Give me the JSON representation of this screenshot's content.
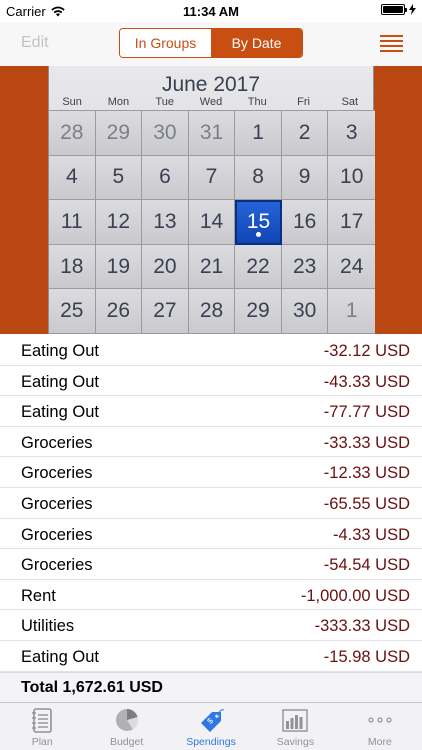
{
  "status": {
    "carrier": "Carrier",
    "time": "11:34 AM"
  },
  "nav": {
    "edit_label": "Edit",
    "segments": [
      {
        "label": "In Groups",
        "selected": false
      },
      {
        "label": "By Date",
        "selected": true
      }
    ],
    "menu_icon": "list-icon"
  },
  "calendar": {
    "title": "June 2017",
    "weekdays": [
      "Sun",
      "Mon",
      "Tue",
      "Wed",
      "Thu",
      "Fri",
      "Sat"
    ],
    "days": [
      {
        "d": "28",
        "cur": false
      },
      {
        "d": "29",
        "cur": false
      },
      {
        "d": "30",
        "cur": false
      },
      {
        "d": "31",
        "cur": false
      },
      {
        "d": "1",
        "cur": true
      },
      {
        "d": "2",
        "cur": true
      },
      {
        "d": "3",
        "cur": true
      },
      {
        "d": "4",
        "cur": true
      },
      {
        "d": "5",
        "cur": true
      },
      {
        "d": "6",
        "cur": true
      },
      {
        "d": "7",
        "cur": true
      },
      {
        "d": "8",
        "cur": true
      },
      {
        "d": "9",
        "cur": true
      },
      {
        "d": "10",
        "cur": true
      },
      {
        "d": "11",
        "cur": true
      },
      {
        "d": "12",
        "cur": true
      },
      {
        "d": "13",
        "cur": true
      },
      {
        "d": "14",
        "cur": true
      },
      {
        "d": "15",
        "cur": true,
        "selected": true,
        "event": true
      },
      {
        "d": "16",
        "cur": true
      },
      {
        "d": "17",
        "cur": true
      },
      {
        "d": "18",
        "cur": true
      },
      {
        "d": "19",
        "cur": true
      },
      {
        "d": "20",
        "cur": true
      },
      {
        "d": "21",
        "cur": true
      },
      {
        "d": "22",
        "cur": true
      },
      {
        "d": "23",
        "cur": true
      },
      {
        "d": "24",
        "cur": true
      },
      {
        "d": "25",
        "cur": true
      },
      {
        "d": "26",
        "cur": true
      },
      {
        "d": "27",
        "cur": true
      },
      {
        "d": "28",
        "cur": true
      },
      {
        "d": "29",
        "cur": true
      },
      {
        "d": "30",
        "cur": true
      },
      {
        "d": "1",
        "cur": false
      }
    ]
  },
  "transactions": [
    {
      "category": "Eating Out",
      "amount": "-32.12 USD"
    },
    {
      "category": "Eating Out",
      "amount": "-43.33 USD"
    },
    {
      "category": "Eating Out",
      "amount": "-77.77 USD"
    },
    {
      "category": "Groceries",
      "amount": "-33.33 USD"
    },
    {
      "category": "Groceries",
      "amount": "-12.33 USD"
    },
    {
      "category": "Groceries",
      "amount": "-65.55 USD"
    },
    {
      "category": "Groceries",
      "amount": "-4.33 USD"
    },
    {
      "category": "Groceries",
      "amount": "-54.54 USD"
    },
    {
      "category": "Rent",
      "amount": "-1,000.00 USD"
    },
    {
      "category": "Utilities",
      "amount": "-333.33 USD"
    },
    {
      "category": "Eating Out",
      "amount": "-15.98 USD"
    }
  ],
  "total_label": "Total 1,672.61 USD",
  "tabs": [
    {
      "label": "Plan",
      "icon": "notebook-icon",
      "active": false
    },
    {
      "label": "Budget",
      "icon": "pie-chart-icon",
      "active": false
    },
    {
      "label": "Spendings",
      "icon": "price-tag-icon",
      "active": true
    },
    {
      "label": "Savings",
      "icon": "bar-chart-icon",
      "active": false
    },
    {
      "label": "More",
      "icon": "more-icon",
      "active": false
    }
  ],
  "colors": {
    "accent": "#c94e12",
    "calendar_bg": "#b94711",
    "selected_day": "#1a55c8",
    "amount": "#6b1010",
    "tab_active": "#2f78e3"
  }
}
